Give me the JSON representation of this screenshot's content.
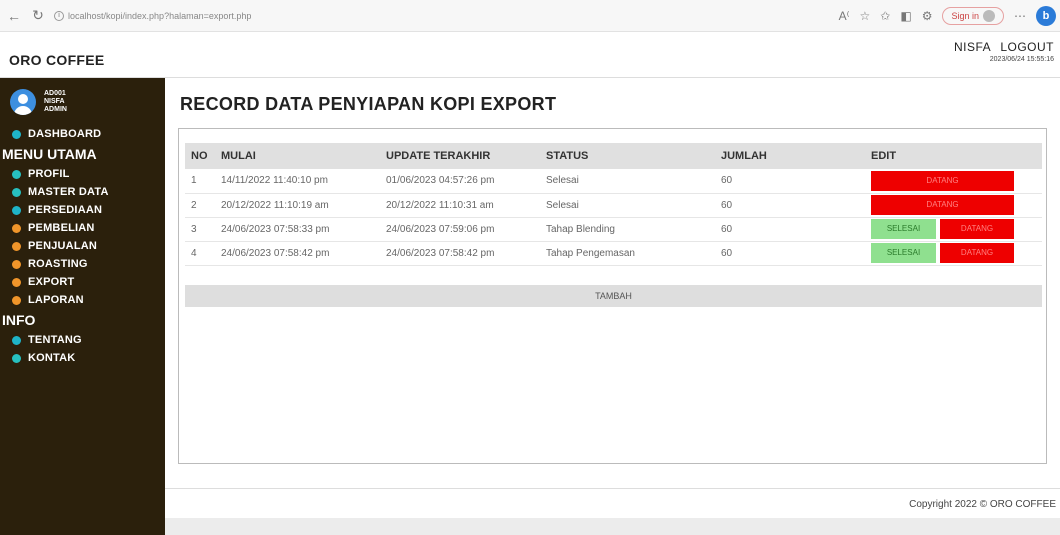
{
  "browser": {
    "url": "localhost/kopi/index.php?halaman=export.php",
    "signin_label": "Sign in",
    "bing_label": "b"
  },
  "header": {
    "brand": "ORO COFFEE",
    "user_name": "NISFA",
    "logout_label": "LOGOUT",
    "timestamp": "2023/06/24 15:55:16"
  },
  "sidebar": {
    "profile": {
      "id": "AD001",
      "name": "NISFA",
      "role": "ADMIN"
    },
    "dashboard": {
      "label": "DASHBOARD",
      "color": "#1fb4c8"
    },
    "section_main": "MENU UTAMA",
    "main_items": [
      {
        "label": "PROFIL",
        "color": "#27c0c0"
      },
      {
        "label": "MASTER DATA",
        "color": "#27c0c0"
      },
      {
        "label": "PERSEDIAAN",
        "color": "#1fb4c8"
      },
      {
        "label": "PEMBELIAN",
        "color": "#f0952a"
      },
      {
        "label": "PENJUALAN",
        "color": "#f0952a"
      },
      {
        "label": "ROASTING",
        "color": "#f0952a"
      },
      {
        "label": "EXPORT",
        "color": "#f0952a"
      },
      {
        "label": "LAPORAN",
        "color": "#f0952a"
      }
    ],
    "section_info": "INFO",
    "info_items": [
      {
        "label": "TENTANG",
        "color": "#1fb4c8"
      },
      {
        "label": "KONTAK",
        "color": "#27c0c0"
      }
    ]
  },
  "page": {
    "title": "RECORD DATA PENYIAPAN KOPI EXPORT",
    "columns": [
      "NO",
      "MULAI",
      "UPDATE TERAKHIR",
      "STATUS",
      "JUMLAH",
      "EDIT"
    ],
    "rows": [
      {
        "no": "1",
        "mulai": "14/11/2022 11:40:10 pm",
        "update": "01/06/2023 04:57:26 pm",
        "status": "Selesai",
        "jumlah": "60",
        "actions": [
          "DATANG"
        ]
      },
      {
        "no": "2",
        "mulai": "20/12/2022 11:10:19 am",
        "update": "20/12/2022 11:10:31 am",
        "status": "Selesai",
        "jumlah": "60",
        "actions": [
          "DATANG"
        ]
      },
      {
        "no": "3",
        "mulai": "24/06/2023 07:58:33 pm",
        "update": "24/06/2023 07:59:06 pm",
        "status": "Tahap Blending",
        "jumlah": "60",
        "actions": [
          "SELESAI",
          "DATANG"
        ]
      },
      {
        "no": "4",
        "mulai": "24/06/2023 07:58:42 pm",
        "update": "24/06/2023 07:58:42 pm",
        "status": "Tahap Pengemasan",
        "jumlah": "60",
        "actions": [
          "SELESAI",
          "DATANG"
        ]
      }
    ],
    "add_label": "TAMBAH"
  },
  "footer": {
    "text": "Copyright 2022 © ORO COFFEE"
  }
}
